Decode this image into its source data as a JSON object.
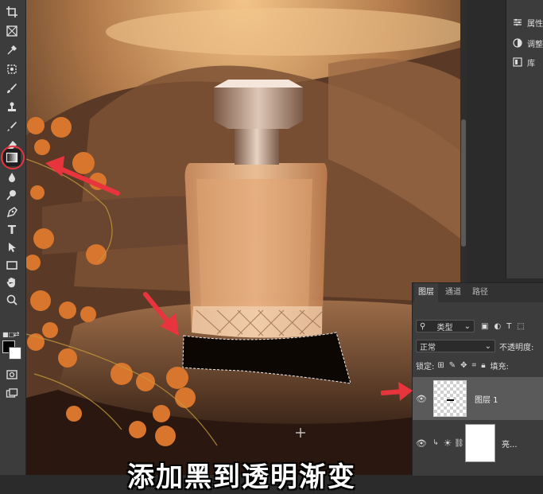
{
  "toolbar": {
    "tools": [
      {
        "icon": "crop-icon"
      },
      {
        "icon": "frame-icon"
      },
      {
        "icon": "eyedropper-icon"
      },
      {
        "icon": "healing-brush-icon"
      },
      {
        "icon": "brush-icon"
      },
      {
        "icon": "clone-stamp-icon"
      },
      {
        "icon": "history-brush-icon"
      },
      {
        "icon": "eraser-icon"
      },
      {
        "icon": "gradient-tool-icon"
      },
      {
        "icon": "blur-tool-icon"
      },
      {
        "icon": "dodge-tool-icon"
      },
      {
        "icon": "pen-tool-icon"
      },
      {
        "icon": "type-tool-icon",
        "glyph": "T"
      },
      {
        "icon": "path-selection-icon"
      },
      {
        "icon": "rectangle-tool-icon"
      },
      {
        "icon": "hand-tool-icon"
      },
      {
        "icon": "zoom-tool-icon"
      }
    ],
    "active_tool": "gradient-tool-icon",
    "foreground_color": "#000000",
    "background_color": "#ffffff"
  },
  "right_dock": {
    "items": [
      {
        "icon": "properties-icon",
        "label": "属性"
      },
      {
        "icon": "adjustments-icon",
        "label": "调整"
      },
      {
        "icon": "libraries-icon",
        "label": "库"
      }
    ]
  },
  "layers_panel": {
    "tabs": [
      "图层",
      "通道",
      "路径"
    ],
    "active_tab": "图层",
    "filter_label": "类型",
    "filter_icons": [
      "image-filter-icon",
      "adjustment-filter-icon",
      "type-filter-icon",
      "shape-filter-icon"
    ],
    "blend_mode": "正常",
    "opacity_label": "不透明度:",
    "lock_label": "锁定:",
    "fill_label": "填充:",
    "layers": [
      {
        "name": "图层 1",
        "selected": true,
        "thumbnail": "transparent-checker"
      },
      {
        "name": "亮...",
        "selected": false,
        "thumbnail": "white-mask",
        "type": "adjustment"
      }
    ]
  },
  "subtitle": "添加黑到透明渐变",
  "annotation_color": "#e8343c"
}
